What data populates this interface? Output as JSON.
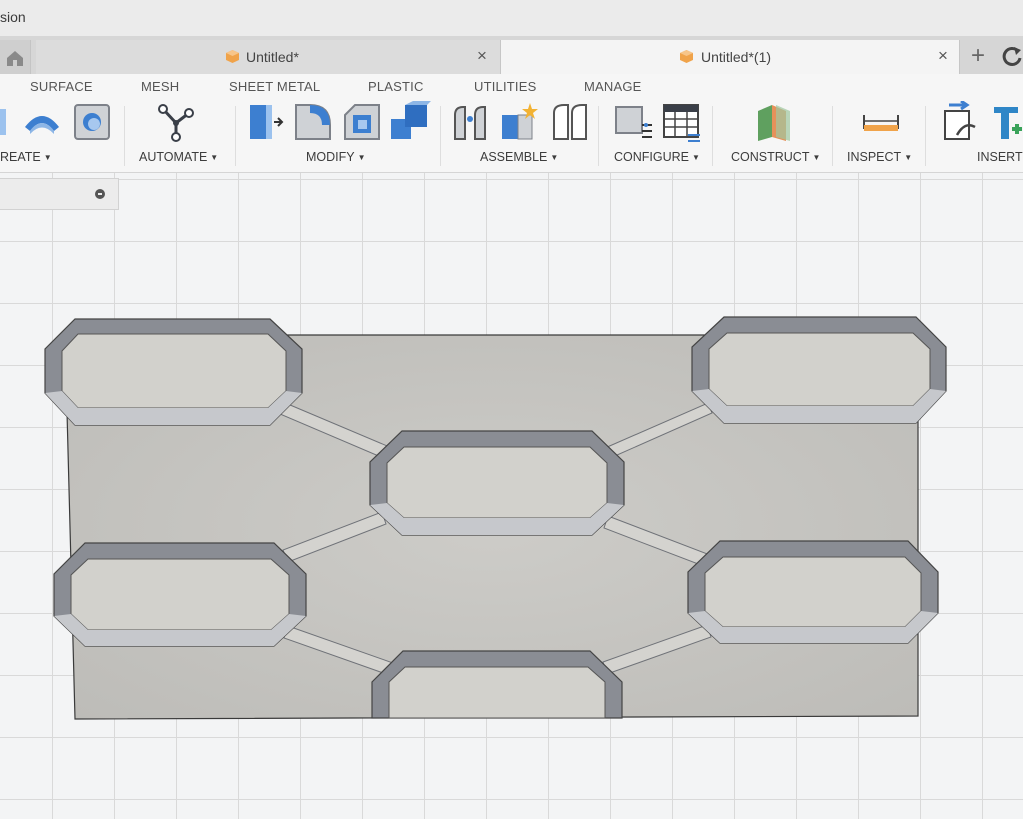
{
  "window": {
    "app_title": "sion"
  },
  "tabs": [
    {
      "label": "Untitled*",
      "active": false
    },
    {
      "label": "Untitled*(1)",
      "active": true
    }
  ],
  "tab_close_glyph": "×",
  "new_tab_glyph": "+",
  "ribbon": {
    "tabs": [
      "SURFACE",
      "MESH",
      "SHEET METAL",
      "PLASTIC",
      "UTILITIES",
      "MANAGE"
    ],
    "groups": [
      "REATE",
      "AUTOMATE",
      "MODIFY",
      "ASSEMBLE",
      "CONFIGURE",
      "CONSTRUCT",
      "INSPECT",
      "INSERT"
    ],
    "dropdown_caret": "▼"
  },
  "icons": [
    "home-icon",
    "document-icon",
    "plus-icon",
    "refresh-icon",
    "extrude-icon",
    "revolve-icon",
    "shell-icon",
    "automate-icon",
    "press-pull-icon",
    "fillet-icon",
    "chamfer-icon",
    "combine-icon",
    "joint-icon",
    "new-component-icon",
    "as-built-joint-icon",
    "configure-icon",
    "table-icon",
    "construct-plane-icon",
    "measure-icon",
    "insert-link-icon",
    "insert-derive-icon"
  ],
  "colors": {
    "accent_blue": "#3d7fd0",
    "doc_orange": "#f0a34a",
    "plate_gray": "#c9c9c6",
    "pocket_face": "#d2d1cc",
    "bevel_dark": "#7f828a",
    "grid_line": "#d9d9d9"
  }
}
